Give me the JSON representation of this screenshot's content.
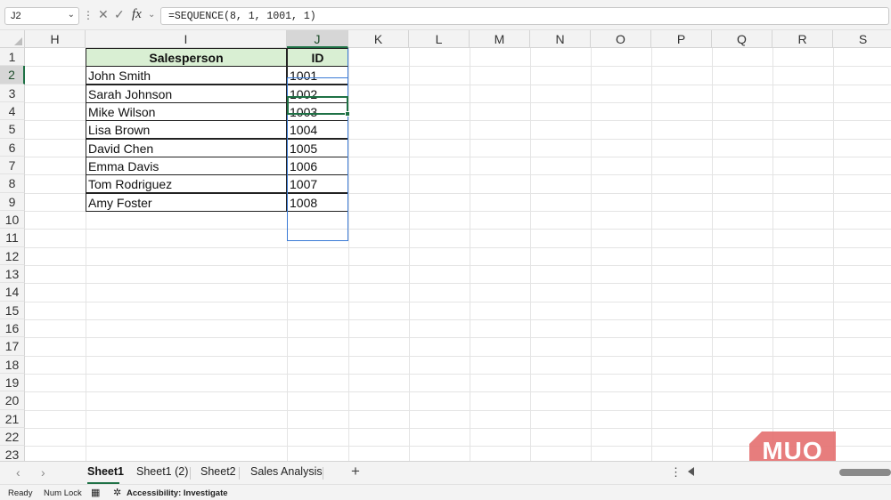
{
  "formula_bar": {
    "name_box": "J2",
    "formula": "=SEQUENCE(8, 1, 1001, 1)",
    "fx_label": "fx"
  },
  "columns": [
    "H",
    "I",
    "J",
    "K",
    "L",
    "M",
    "N",
    "O",
    "P",
    "Q",
    "R",
    "S"
  ],
  "rows": [
    "1",
    "2",
    "3",
    "4",
    "5",
    "6",
    "7",
    "8",
    "9",
    "10",
    "11",
    "12",
    "13",
    "14",
    "15",
    "16",
    "17",
    "18",
    "19",
    "20",
    "21",
    "22",
    "23"
  ],
  "table": {
    "headers": [
      "Salesperson",
      "ID"
    ],
    "rows": [
      [
        "John Smith",
        "1001"
      ],
      [
        "Sarah Johnson",
        "1002"
      ],
      [
        "Mike Wilson",
        "1003"
      ],
      [
        "Lisa Brown",
        "1004"
      ],
      [
        "David Chen",
        "1005"
      ],
      [
        "Emma Davis",
        "1006"
      ],
      [
        "Tom Rodriguez",
        "1007"
      ],
      [
        "Amy Foster",
        "1008"
      ]
    ]
  },
  "sheet_tabs": [
    "Sheet1",
    "Sheet1 (2)",
    "Sheet2",
    "Sales Analysis"
  ],
  "active_tab": "Sheet1",
  "status_bar": {
    "ready": "Ready",
    "num_lock": "Num Lock",
    "accessibility": "Accessibility: Investigate"
  },
  "watermark": "MUO",
  "colors": {
    "accent": "#1e7145",
    "header_fill": "#d9efd3",
    "spill_border": "#3a7ad6",
    "watermark": "#e57373"
  },
  "icons": [
    "chevron-down-icon",
    "cancel-icon",
    "check-icon",
    "function-icon",
    "sheet-prev-icon",
    "sheet-next-icon",
    "add-sheet-icon",
    "page-layout-icon",
    "accessibility-icon"
  ]
}
